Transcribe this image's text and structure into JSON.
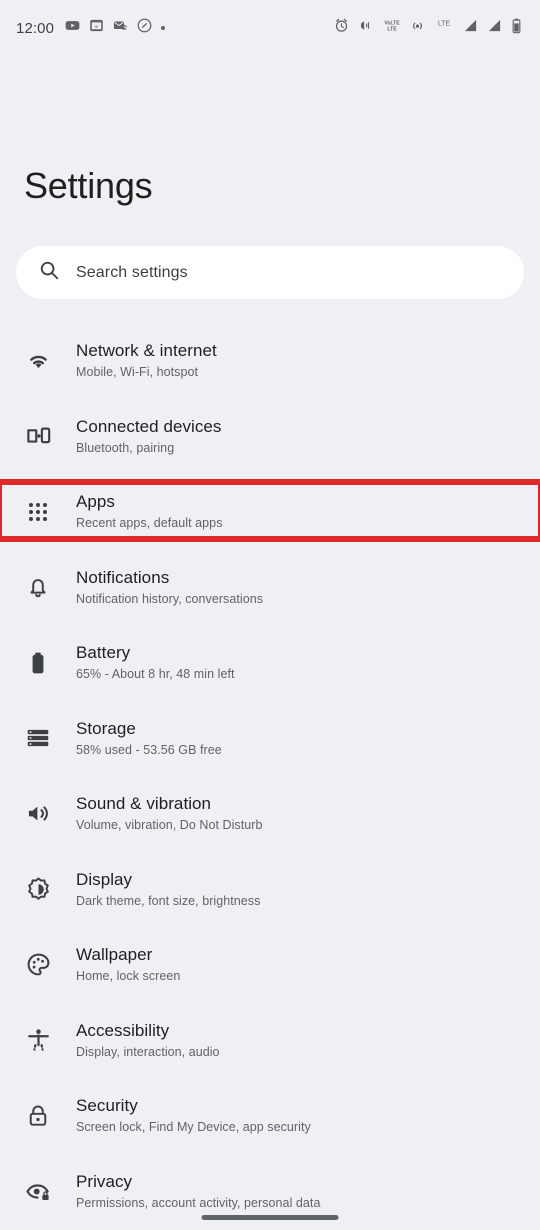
{
  "status_bar": {
    "time": "12:00",
    "left_icons": [
      {
        "name": "youtube-icon",
        "label": "YouTube"
      },
      {
        "name": "calendar-app-icon",
        "label": "Calendar"
      },
      {
        "name": "email-icon",
        "label": "Email"
      },
      {
        "name": "shazam-icon",
        "label": "Shazam"
      },
      {
        "name": "more-notifications-dot",
        "label": "More"
      }
    ],
    "right_icons": [
      {
        "name": "alarm-clock-icon",
        "label": "Alarm set"
      },
      {
        "name": "vibrate-icon",
        "label": "Ringer vibrate"
      },
      {
        "name": "volte-icon",
        "label": "VoLTE"
      },
      {
        "name": "hotspot-icon",
        "label": "Hotspot"
      },
      {
        "name": "lte-icon",
        "label": "LTE"
      },
      {
        "name": "signal-bars-icon-1",
        "label": "Signal SIM 1"
      },
      {
        "name": "signal-bars-icon-2",
        "label": "Signal SIM 2"
      },
      {
        "name": "battery-icon",
        "label": "Battery"
      }
    ],
    "network_label": "LTE",
    "volte_label_top": "VoLTE",
    "volte_label_bottom": "LTE"
  },
  "header": {
    "title": "Settings"
  },
  "search": {
    "placeholder": "Search settings",
    "icon": "search-icon"
  },
  "colors": {
    "background": "#eff0f4",
    "surface": "#ffffff",
    "title_text": "#1f1f1f",
    "subtitle_text": "#5f6368",
    "icon": "#3c4043",
    "highlight_red": "#e02a2a",
    "nav_pill": "#5f6368"
  },
  "highlight": {
    "target": "Apps",
    "color": "#e02a2a",
    "border_width_px": 6
  },
  "settings_items": [
    {
      "id": "network-internet",
      "icon": "wifi-icon",
      "title": "Network & internet",
      "subtitle": "Mobile, Wi-Fi, hotspot",
      "highlighted": false
    },
    {
      "id": "connected-devices",
      "icon": "connected-devices-icon",
      "title": "Connected devices",
      "subtitle": "Bluetooth, pairing",
      "highlighted": false
    },
    {
      "id": "apps",
      "icon": "apps-grid-icon",
      "title": "Apps",
      "subtitle": "Recent apps, default apps",
      "highlighted": true
    },
    {
      "id": "notifications",
      "icon": "bell-icon",
      "title": "Notifications",
      "subtitle": "Notification history, conversations",
      "highlighted": false
    },
    {
      "id": "battery",
      "icon": "battery-icon",
      "title": "Battery",
      "subtitle": "65% - About 8 hr, 48 min left",
      "highlighted": false
    },
    {
      "id": "storage",
      "icon": "storage-icon",
      "title": "Storage",
      "subtitle": "58% used - 53.56 GB free",
      "highlighted": false
    },
    {
      "id": "sound-vibration",
      "icon": "volume-icon",
      "title": "Sound & vibration",
      "subtitle": "Volume, vibration, Do Not Disturb",
      "highlighted": false
    },
    {
      "id": "display",
      "icon": "brightness-icon",
      "title": "Display",
      "subtitle": "Dark theme, font size, brightness",
      "highlighted": false
    },
    {
      "id": "wallpaper",
      "icon": "palette-icon",
      "title": "Wallpaper",
      "subtitle": "Home, lock screen",
      "highlighted": false
    },
    {
      "id": "accessibility",
      "icon": "accessibility-icon",
      "title": "Accessibility",
      "subtitle": "Display, interaction, audio",
      "highlighted": false
    },
    {
      "id": "security",
      "icon": "lock-icon",
      "title": "Security",
      "subtitle": "Screen lock, Find My Device, app security",
      "highlighted": false
    },
    {
      "id": "privacy",
      "icon": "privacy-eye-icon",
      "title": "Privacy",
      "subtitle": "Permissions, account activity, personal data",
      "highlighted": false
    }
  ],
  "navigation": {
    "pill": "home-gesture-pill"
  }
}
